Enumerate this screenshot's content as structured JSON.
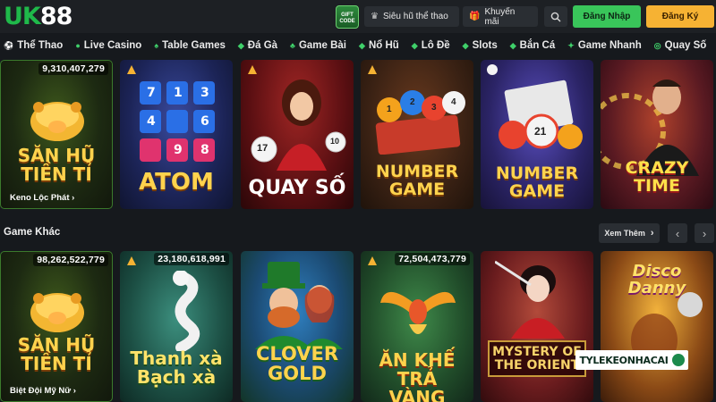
{
  "header": {
    "logo_part1": "UK",
    "logo_part2": "88",
    "gift_code_label": "GIFT CODE",
    "btn_sports_jackpot": "Siêu hũ thể thao",
    "btn_promotions": "Khuyến mãi",
    "login_label": "Đăng Nhập",
    "register_label": "Đăng Ký"
  },
  "nav": {
    "items": [
      {
        "label": "Thể Thao",
        "icon": "soccer-icon"
      },
      {
        "label": "Live Casino",
        "icon": "live-icon"
      },
      {
        "label": "Table Games",
        "icon": "cards-icon"
      },
      {
        "label": "Đá Gà",
        "icon": "rooster-icon"
      },
      {
        "label": "Game Bài",
        "icon": "cards-icon"
      },
      {
        "label": "Nổ Hũ",
        "icon": "jar-icon"
      },
      {
        "label": "Lô Đề",
        "icon": "lottery-icon"
      },
      {
        "label": "Slots",
        "icon": "slot-icon"
      },
      {
        "label": "Bắn Cá",
        "icon": "fish-icon"
      },
      {
        "label": "Game Nhanh",
        "icon": "lightning-icon"
      },
      {
        "label": "Quay Số",
        "icon": "wheel-icon"
      }
    ]
  },
  "row1": {
    "cards": [
      {
        "title": "SĂN HŨ TIỀN TỈ",
        "jackpot": "9,310,407,279",
        "caption": "Keno Lộc Phát ›"
      },
      {
        "title": "ATOM",
        "numbers": [
          "7",
          "1",
          "3",
          "4",
          "6",
          "9",
          "8"
        ]
      },
      {
        "title": "QUAY SỐ",
        "balls": [
          "17",
          "10"
        ]
      },
      {
        "title": "NUMBER GAME",
        "balls": [
          "1",
          "2",
          "3",
          "4"
        ]
      },
      {
        "title": "NUMBER GAME",
        "balls": [
          "21"
        ]
      },
      {
        "title": "CRAZY TIME"
      }
    ]
  },
  "section": {
    "title": "Game Khác",
    "see_more": "Xem Thêm"
  },
  "row2": {
    "cards": [
      {
        "title": "SĂN HŨ TIỀN TỈ",
        "jackpot": "98,262,522,779",
        "caption": "Biệt Đội Mỹ Nữ ›"
      },
      {
        "title": "Thanh xà Bạch xà",
        "jackpot": "23,180,618,991"
      },
      {
        "title": "CLOVER GOLD"
      },
      {
        "title": "ĂN KHẾ TRẢ VÀNG",
        "jackpot": "72,504,473,779"
      },
      {
        "title": "MYSTERY OF THE ORIENT"
      },
      {
        "title": "Disco Danny"
      }
    ]
  },
  "watermark": "TYLEKEONHACAI",
  "colors": {
    "accent_green": "#39c55a",
    "accent_orange": "#f6b233",
    "background": "#16191d"
  }
}
